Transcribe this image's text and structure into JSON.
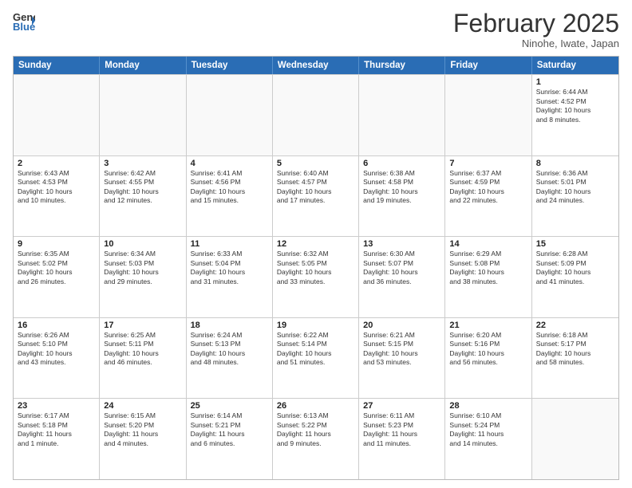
{
  "header": {
    "logo_general": "General",
    "logo_blue": "Blue",
    "month_title": "February 2025",
    "location": "Ninohe, Iwate, Japan"
  },
  "weekdays": [
    "Sunday",
    "Monday",
    "Tuesday",
    "Wednesday",
    "Thursday",
    "Friday",
    "Saturday"
  ],
  "rows": [
    [
      {
        "day": "",
        "info": ""
      },
      {
        "day": "",
        "info": ""
      },
      {
        "day": "",
        "info": ""
      },
      {
        "day": "",
        "info": ""
      },
      {
        "day": "",
        "info": ""
      },
      {
        "day": "",
        "info": ""
      },
      {
        "day": "1",
        "info": "Sunrise: 6:44 AM\nSunset: 4:52 PM\nDaylight: 10 hours\nand 8 minutes."
      }
    ],
    [
      {
        "day": "2",
        "info": "Sunrise: 6:43 AM\nSunset: 4:53 PM\nDaylight: 10 hours\nand 10 minutes."
      },
      {
        "day": "3",
        "info": "Sunrise: 6:42 AM\nSunset: 4:55 PM\nDaylight: 10 hours\nand 12 minutes."
      },
      {
        "day": "4",
        "info": "Sunrise: 6:41 AM\nSunset: 4:56 PM\nDaylight: 10 hours\nand 15 minutes."
      },
      {
        "day": "5",
        "info": "Sunrise: 6:40 AM\nSunset: 4:57 PM\nDaylight: 10 hours\nand 17 minutes."
      },
      {
        "day": "6",
        "info": "Sunrise: 6:38 AM\nSunset: 4:58 PM\nDaylight: 10 hours\nand 19 minutes."
      },
      {
        "day": "7",
        "info": "Sunrise: 6:37 AM\nSunset: 4:59 PM\nDaylight: 10 hours\nand 22 minutes."
      },
      {
        "day": "8",
        "info": "Sunrise: 6:36 AM\nSunset: 5:01 PM\nDaylight: 10 hours\nand 24 minutes."
      }
    ],
    [
      {
        "day": "9",
        "info": "Sunrise: 6:35 AM\nSunset: 5:02 PM\nDaylight: 10 hours\nand 26 minutes."
      },
      {
        "day": "10",
        "info": "Sunrise: 6:34 AM\nSunset: 5:03 PM\nDaylight: 10 hours\nand 29 minutes."
      },
      {
        "day": "11",
        "info": "Sunrise: 6:33 AM\nSunset: 5:04 PM\nDaylight: 10 hours\nand 31 minutes."
      },
      {
        "day": "12",
        "info": "Sunrise: 6:32 AM\nSunset: 5:05 PM\nDaylight: 10 hours\nand 33 minutes."
      },
      {
        "day": "13",
        "info": "Sunrise: 6:30 AM\nSunset: 5:07 PM\nDaylight: 10 hours\nand 36 minutes."
      },
      {
        "day": "14",
        "info": "Sunrise: 6:29 AM\nSunset: 5:08 PM\nDaylight: 10 hours\nand 38 minutes."
      },
      {
        "day": "15",
        "info": "Sunrise: 6:28 AM\nSunset: 5:09 PM\nDaylight: 10 hours\nand 41 minutes."
      }
    ],
    [
      {
        "day": "16",
        "info": "Sunrise: 6:26 AM\nSunset: 5:10 PM\nDaylight: 10 hours\nand 43 minutes."
      },
      {
        "day": "17",
        "info": "Sunrise: 6:25 AM\nSunset: 5:11 PM\nDaylight: 10 hours\nand 46 minutes."
      },
      {
        "day": "18",
        "info": "Sunrise: 6:24 AM\nSunset: 5:13 PM\nDaylight: 10 hours\nand 48 minutes."
      },
      {
        "day": "19",
        "info": "Sunrise: 6:22 AM\nSunset: 5:14 PM\nDaylight: 10 hours\nand 51 minutes."
      },
      {
        "day": "20",
        "info": "Sunrise: 6:21 AM\nSunset: 5:15 PM\nDaylight: 10 hours\nand 53 minutes."
      },
      {
        "day": "21",
        "info": "Sunrise: 6:20 AM\nSunset: 5:16 PM\nDaylight: 10 hours\nand 56 minutes."
      },
      {
        "day": "22",
        "info": "Sunrise: 6:18 AM\nSunset: 5:17 PM\nDaylight: 10 hours\nand 58 minutes."
      }
    ],
    [
      {
        "day": "23",
        "info": "Sunrise: 6:17 AM\nSunset: 5:18 PM\nDaylight: 11 hours\nand 1 minute."
      },
      {
        "day": "24",
        "info": "Sunrise: 6:15 AM\nSunset: 5:20 PM\nDaylight: 11 hours\nand 4 minutes."
      },
      {
        "day": "25",
        "info": "Sunrise: 6:14 AM\nSunset: 5:21 PM\nDaylight: 11 hours\nand 6 minutes."
      },
      {
        "day": "26",
        "info": "Sunrise: 6:13 AM\nSunset: 5:22 PM\nDaylight: 11 hours\nand 9 minutes."
      },
      {
        "day": "27",
        "info": "Sunrise: 6:11 AM\nSunset: 5:23 PM\nDaylight: 11 hours\nand 11 minutes."
      },
      {
        "day": "28",
        "info": "Sunrise: 6:10 AM\nSunset: 5:24 PM\nDaylight: 11 hours\nand 14 minutes."
      },
      {
        "day": "",
        "info": ""
      }
    ]
  ]
}
